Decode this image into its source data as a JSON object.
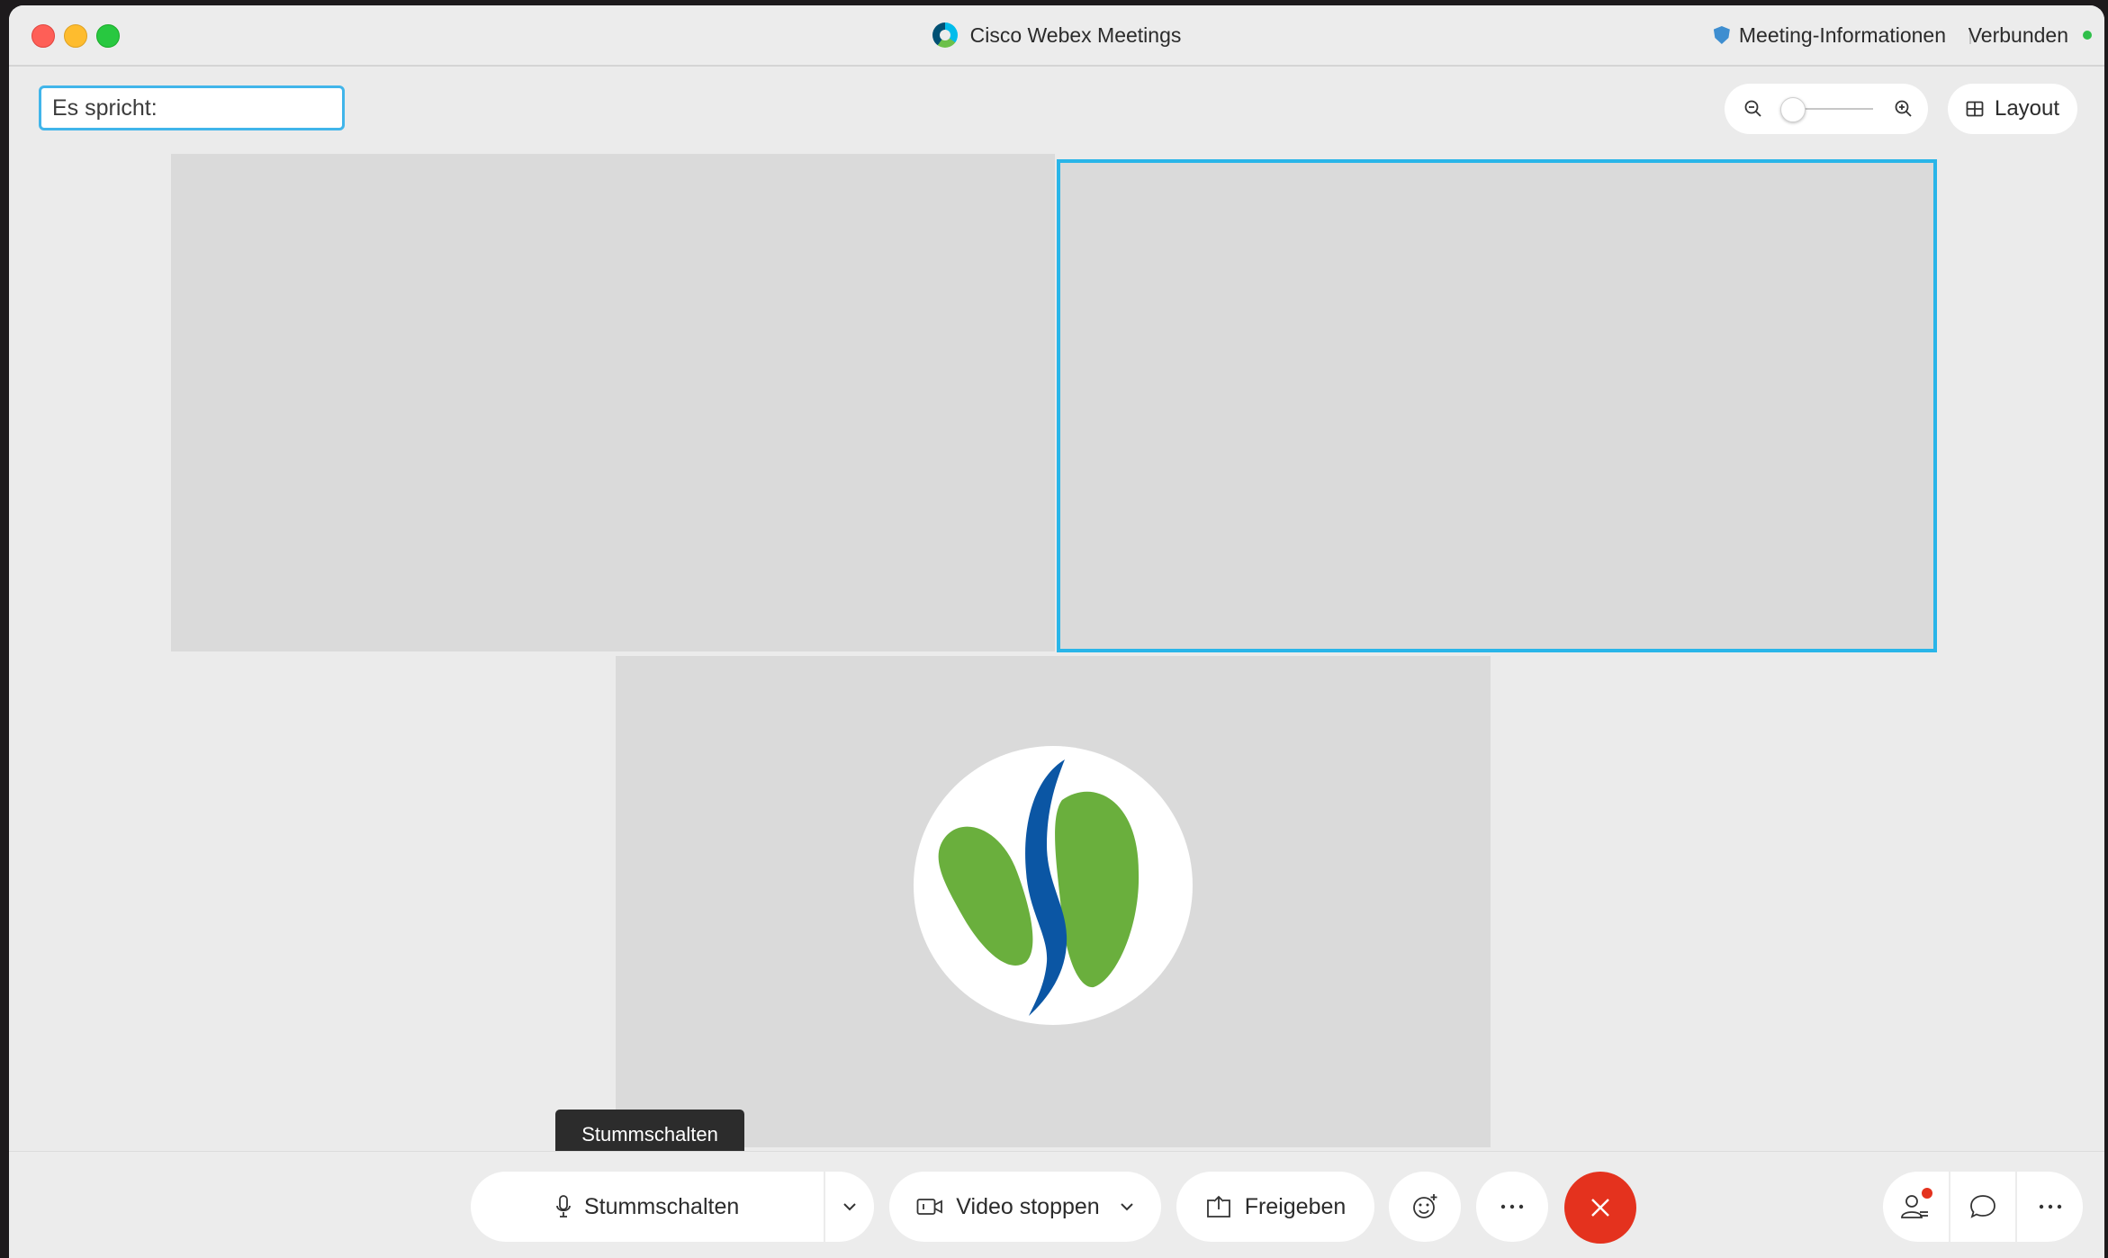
{
  "window": {
    "title": "Cisco Webex Meetings",
    "meeting_info_label": "Meeting-Informationen",
    "connection_status": "Verbunden"
  },
  "toolbar": {
    "speaker_label": "Es spricht:",
    "zoom_level": 0.1,
    "layout_label": "Layout"
  },
  "video_grid": {
    "tiles": [
      {
        "name": "participant-tile-1",
        "active": false
      },
      {
        "name": "participant-tile-2",
        "active": true
      },
      {
        "name": "participant-tile-3",
        "active": false,
        "avatar": "logo-avatar"
      }
    ]
  },
  "tooltip": {
    "text": "Stummschalten"
  },
  "controls": {
    "mute_label": "Stummschalten",
    "video_label": "Video stoppen",
    "share_label": "Freigeben",
    "reaction_icon": "smiley-add-icon",
    "more_icon": "more-horizontal-icon",
    "end_icon": "close-icon"
  },
  "side_controls": {
    "participants_icon": "participants-icon",
    "chat_icon": "chat-bubble-icon",
    "more_icon": "more-horizontal-icon"
  },
  "colors": {
    "active_border": "#29b5e8",
    "end_call": "#e4321e",
    "connected": "#2fbf4a",
    "logo_green": "#6aaf3d",
    "logo_blue": "#0b56a4"
  }
}
